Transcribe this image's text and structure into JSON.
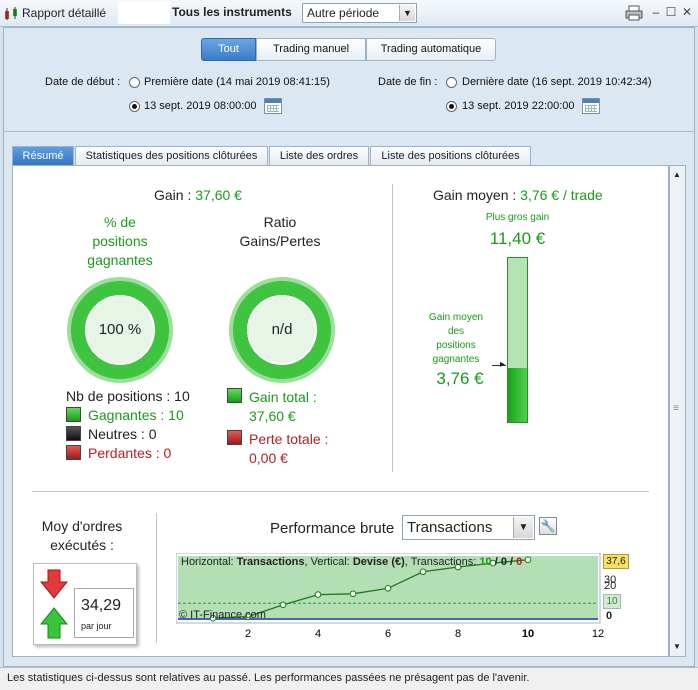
{
  "window": {
    "app_title": "Rapport détaillé",
    "instruments_label": "Tous les instruments",
    "period_value": "Autre période"
  },
  "mode_tabs": [
    "Tout",
    "Trading manuel",
    "Trading automatique"
  ],
  "dates": {
    "start_label": "Date de début :",
    "start_first": "Première date (14 mai 2019 08:41:15)",
    "start_custom": "13 sept. 2019 08:00:00",
    "end_label": "Date de fin :",
    "end_last": "Dernière date (16 sept. 2019 10:42:34)",
    "end_custom": "13 sept. 2019 22:00:00"
  },
  "tabs": [
    "Résumé",
    "Statistiques des positions clôturées",
    "Liste des ordres",
    "Liste des positions clôturées"
  ],
  "summary": {
    "gain_label": "Gain :",
    "gain_value": "37,60 €",
    "pct_label_1": "% de",
    "pct_label_2": "positions",
    "pct_label_3": "gagnantes",
    "pct_value": "100 %",
    "ratio_label_1": "Ratio",
    "ratio_label_2": "Gains/Pertes",
    "ratio_value": "n/d",
    "nb_positions": "Nb de positions : 10",
    "winners": "Gagnantes : 10",
    "neutral": "Neutres : 0",
    "losers": "Perdantes : 0",
    "total_gain_label": "Gain total :",
    "total_gain_value": "37,60 €",
    "total_loss_label": "Perte totale :",
    "total_loss_value": "0,00 €",
    "avg_gain_label": "Gain moyen :",
    "avg_gain_value": "3,76 € / trade",
    "biggest_label": "Plus gros gain",
    "biggest_value": "11,40 €",
    "avg_win_label_1": "Gain moyen",
    "avg_win_label_2": "des",
    "avg_win_label_3": "positions",
    "avg_win_label_4": "gagnantes",
    "avg_win_value": "3,76 €",
    "avg_fill_fraction": 0.33
  },
  "orders": {
    "label_1": "Moy d'ordres",
    "label_2": "exécutés :",
    "value": "34,29",
    "unit": "par jour"
  },
  "performance": {
    "title": "Performance brute",
    "select_value": "Transactions",
    "info_prefix": "Horizontal:",
    "info_h": "Transactions",
    "info_mid": ", Vertical:",
    "info_v": "Devise (€)",
    "info_suffix": ", Transactions:",
    "info_counts_green": "10",
    "info_counts_sep": " / 0 / ",
    "info_counts_red": "0",
    "copyright": "© IT-Finance.com",
    "badge_top": "37,6",
    "badge_mid": "10",
    "y_ticks": [
      "30",
      "20",
      "0"
    ]
  },
  "chart_data": {
    "type": "line",
    "x": [
      1,
      2,
      3,
      4,
      5,
      6,
      7,
      8,
      9,
      10
    ],
    "y": [
      0.5,
      1.5,
      9.0,
      15.5,
      16.0,
      19.5,
      30.0,
      33.0,
      35.5,
      37.6
    ],
    "xticks": [
      "2",
      "4",
      "6",
      "8",
      "10",
      "12"
    ],
    "xlim": [
      0,
      12
    ],
    "ylim": [
      0,
      40
    ],
    "average_line": 10,
    "fill_color": "#a7d8a7",
    "line_color": "#1b7a1b"
  },
  "footer": "Les statistiques ci-dessus sont relatives au passé. Les performances passées ne présagent pas de l'avenir."
}
